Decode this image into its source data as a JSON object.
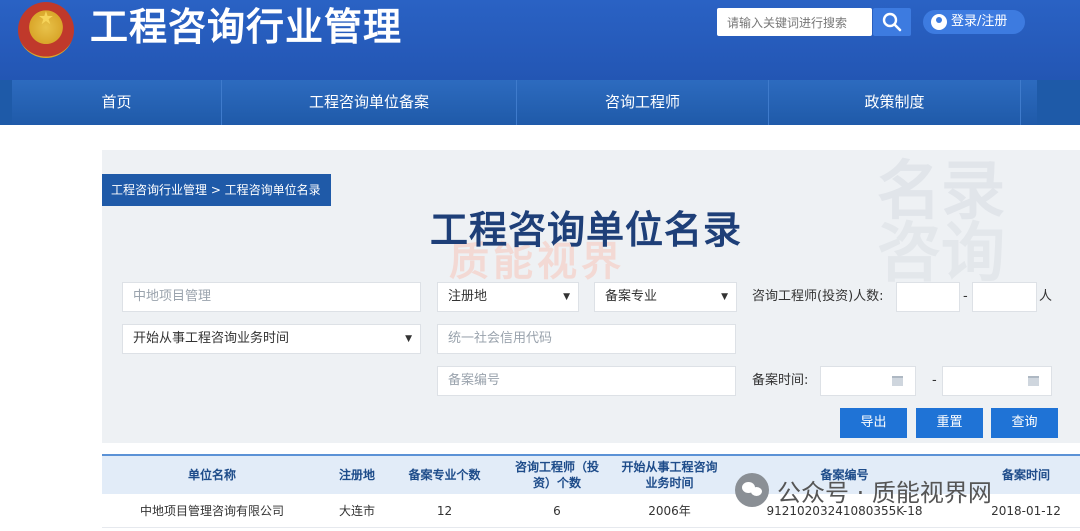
{
  "header": {
    "site_title": "工程咨询行业管理",
    "search_placeholder": "请输入关键词进行搜索",
    "login_label": "登录/注册"
  },
  "nav": {
    "items": [
      "首页",
      "工程咨询单位备案",
      "咨询工程师",
      "政策制度"
    ]
  },
  "breadcrumb": "工程咨询行业管理 > 工程咨询单位名录",
  "page_title": "工程咨询单位名录",
  "watermarks": {
    "bg_line1": "名录",
    "bg_line2": "咨询",
    "red": "质能视界"
  },
  "filters": {
    "name_value": "中地项目管理",
    "region_select": "注册地",
    "specialty_select": "备案专业",
    "engineer_count_label": "咨询工程师(投资)人数:",
    "range_dash": "-",
    "count_unit": "人",
    "start_time_select": "开始从事工程咨询业务时间",
    "credit_code_placeholder": "统一社会信用代码",
    "record_no_placeholder": "备案编号",
    "record_time_label": "备案时间:"
  },
  "buttons": {
    "export": "导出",
    "reset": "重置",
    "query": "查询"
  },
  "table": {
    "headers": [
      "单位名称",
      "注册地",
      "备案专业个数",
      "咨询工程师（投资）个数",
      "开始从事工程咨询业务时间",
      "备案编号",
      "备案时间"
    ],
    "rows": [
      [
        "中地项目管理咨询有限公司",
        "大连市",
        "12",
        "6",
        "2006年",
        "91210203241080355K-18",
        "2018-01-12"
      ]
    ]
  },
  "wechat_watermark": "公众号 · 质能视界网",
  "colors": {
    "header_blue": "#2356b4",
    "nav_blue": "#1f5aa9",
    "button_blue": "#1f73d6",
    "title_navy": "#1e3f78"
  }
}
